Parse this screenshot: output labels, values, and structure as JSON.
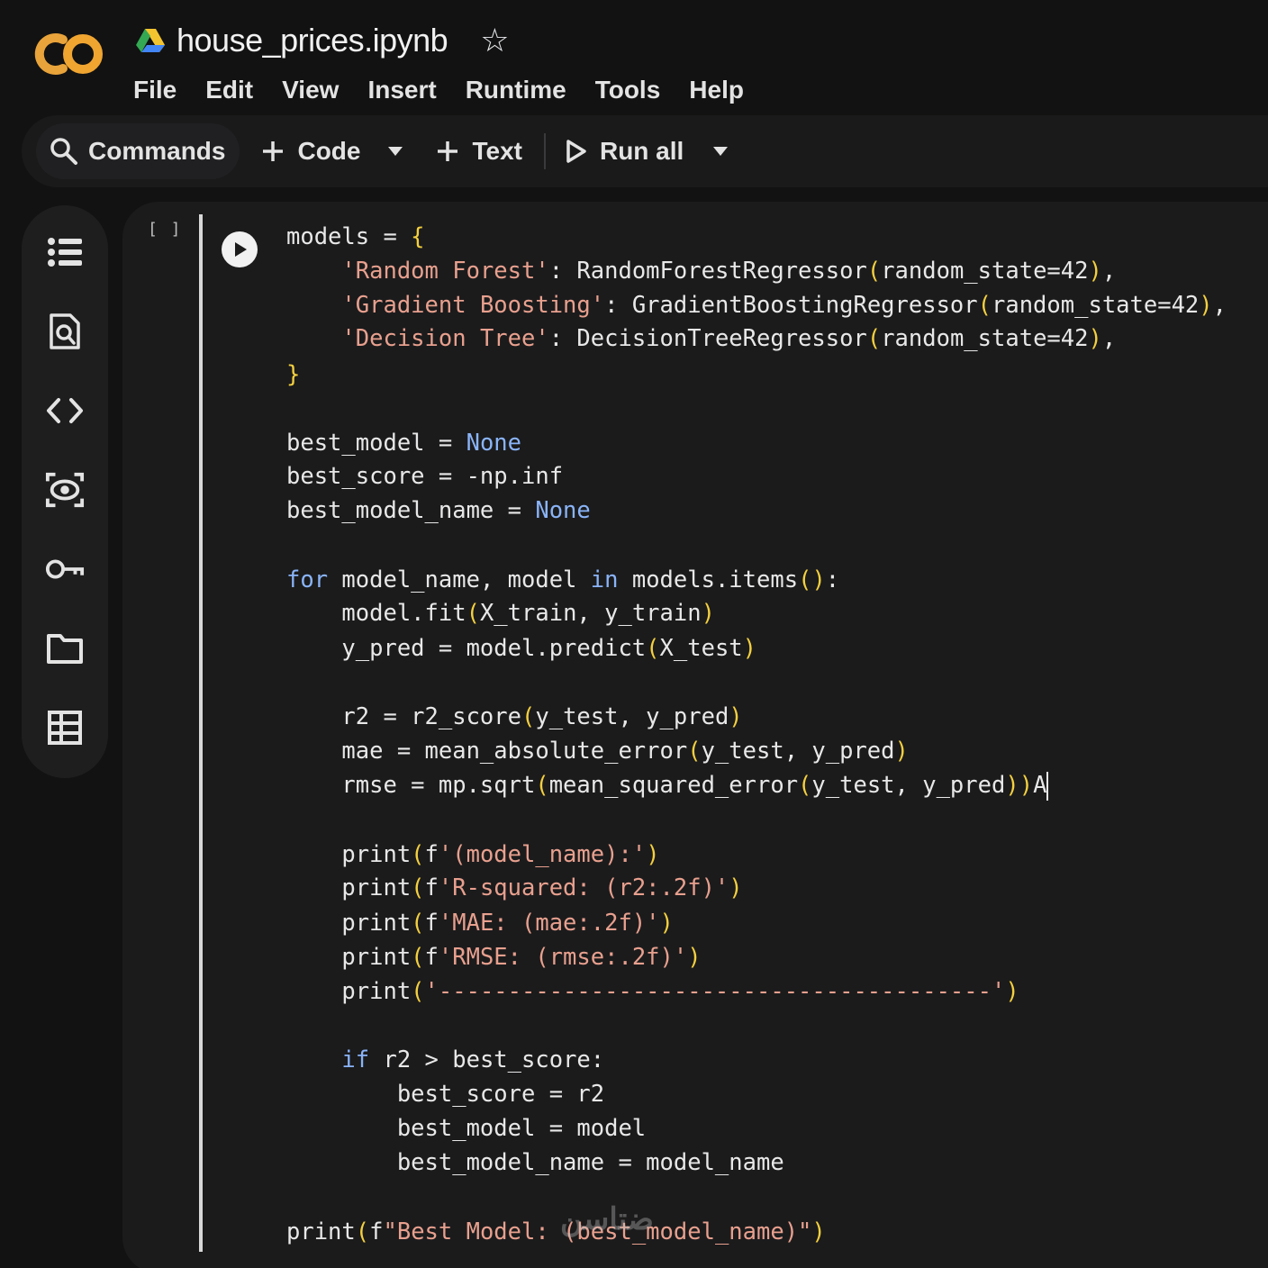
{
  "app": {
    "logo_text": "CO",
    "notebook_title": "house_prices.ipynb"
  },
  "menu": [
    "File",
    "Edit",
    "View",
    "Insert",
    "Runtime",
    "Tools",
    "Help"
  ],
  "toolbar": {
    "commands": "Commands",
    "code": "Code",
    "text": "Text",
    "run_all": "Run all"
  },
  "sidebar": {
    "items": [
      "table-of-contents-icon",
      "find-icon",
      "code-snippets-icon",
      "variables-icon",
      "secrets-icon",
      "files-icon",
      "data-table-icon"
    ]
  },
  "cell": {
    "execution_count": "[ ]",
    "lines": [
      "models = {",
      "    'Random Forest': RandomForestRegressor(random_state=42),",
      "    'Gradient Boosting': GradientBoostingRegressor(random_state=42),",
      "    'Decision Tree': DecisionTreeRegressor(random_state=42),",
      "}",
      "",
      "best_model = None",
      "best_score = -np.inf",
      "best_model_name = None",
      "",
      "for model_name, model in models.items():",
      "    model.fit(X_train, y_train)",
      "    y_pred = model.predict(X_test)",
      "",
      "    r2 = r2_score(y_test, y_pred)",
      "    mae = mean_absolute_error(y_test, y_pred)",
      "    rmse = mp.sqrt(mean_squared_error(y_test, y_pred))A",
      "",
      "    print(f'(model_name):')",
      "    print(f'R-squared: (r2:.2f)')",
      "    print(f'MAE: (mae:.2f)')",
      "    print(f'RMSE: (rmse:.2f)')",
      "    print('----------------------------------------')",
      "",
      "    if r2 > best_score:",
      "        best_score = r2",
      "        best_model = model",
      "        best_model_name = model_name",
      "",
      "print(f\"Best Model: (best_model_name)\")"
    ]
  },
  "watermark": "ضتاسن"
}
